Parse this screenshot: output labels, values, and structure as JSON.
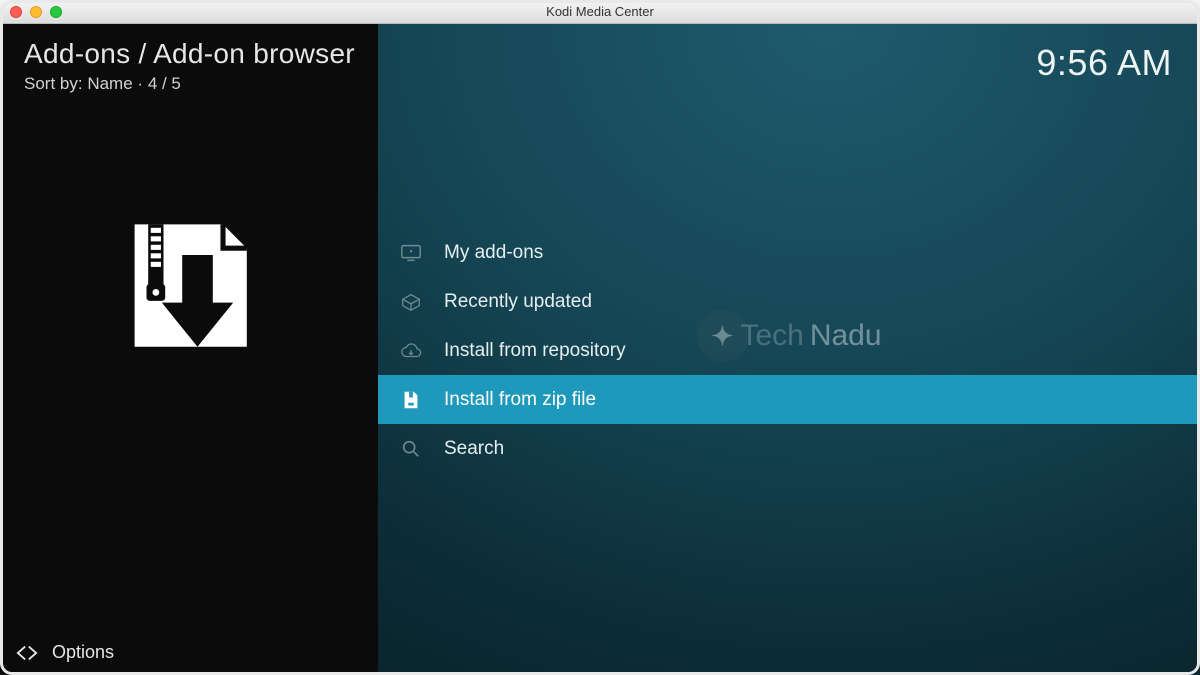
{
  "titlebar": {
    "title": "Kodi Media Center"
  },
  "header": {
    "breadcrumb": "Add-ons / Add-on browser",
    "sort_label": "Sort by:",
    "sort_value": "Name",
    "position": "4 / 5",
    "options_label": "Options"
  },
  "clock": "9:56 AM",
  "menu": {
    "items": [
      {
        "label": "My add-ons",
        "icon": "monitor-icon",
        "selected": false
      },
      {
        "label": "Recently updated",
        "icon": "open-box-icon",
        "selected": false
      },
      {
        "label": "Install from repository",
        "icon": "cloud-download-icon",
        "selected": false
      },
      {
        "label": "Install from zip file",
        "icon": "zip-file-icon",
        "selected": true
      },
      {
        "label": "Search",
        "icon": "search-icon",
        "selected": false
      }
    ]
  },
  "watermark": {
    "brand_first": "Tech",
    "brand_second": "Nadu"
  }
}
